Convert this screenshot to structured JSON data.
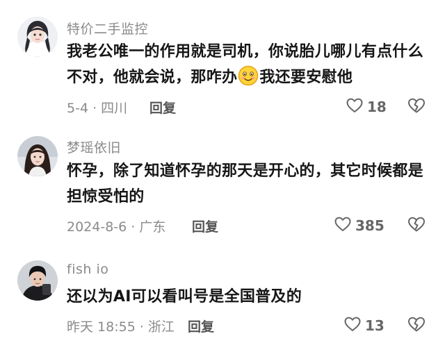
{
  "comments": [
    {
      "username": "特价二手监控",
      "text_before_emoji": "我老公唯一的作用就是司机，你说胎儿哪儿有点什么不对，他就会说，那咋办",
      "emoji": "smiling-face-emoji",
      "text_after_emoji": "我还要安慰他",
      "meta": "5-4 · 四川",
      "reply_label": "回复",
      "likes": "18"
    },
    {
      "username": "梦瑶依旧",
      "text": "怀孕，除了知道怀孕的那天是开心的，其它时候都是担惊受怕的",
      "meta": "2024-8-6 · 广东",
      "reply_label": "回复",
      "likes": "385"
    },
    {
      "username": "fish io",
      "text": "还以为AI可以看叫号是全国普及的",
      "meta": "昨天 18:55 · 浙江",
      "reply_label": "回复",
      "likes": "13"
    }
  ],
  "colors": {
    "username": "#8a8a8a",
    "body_text": "#161616",
    "meta": "#8a8a8a",
    "icon": "#666666"
  },
  "icons": {
    "like": "heart-outline-icon",
    "dislike": "broken-heart-icon"
  }
}
